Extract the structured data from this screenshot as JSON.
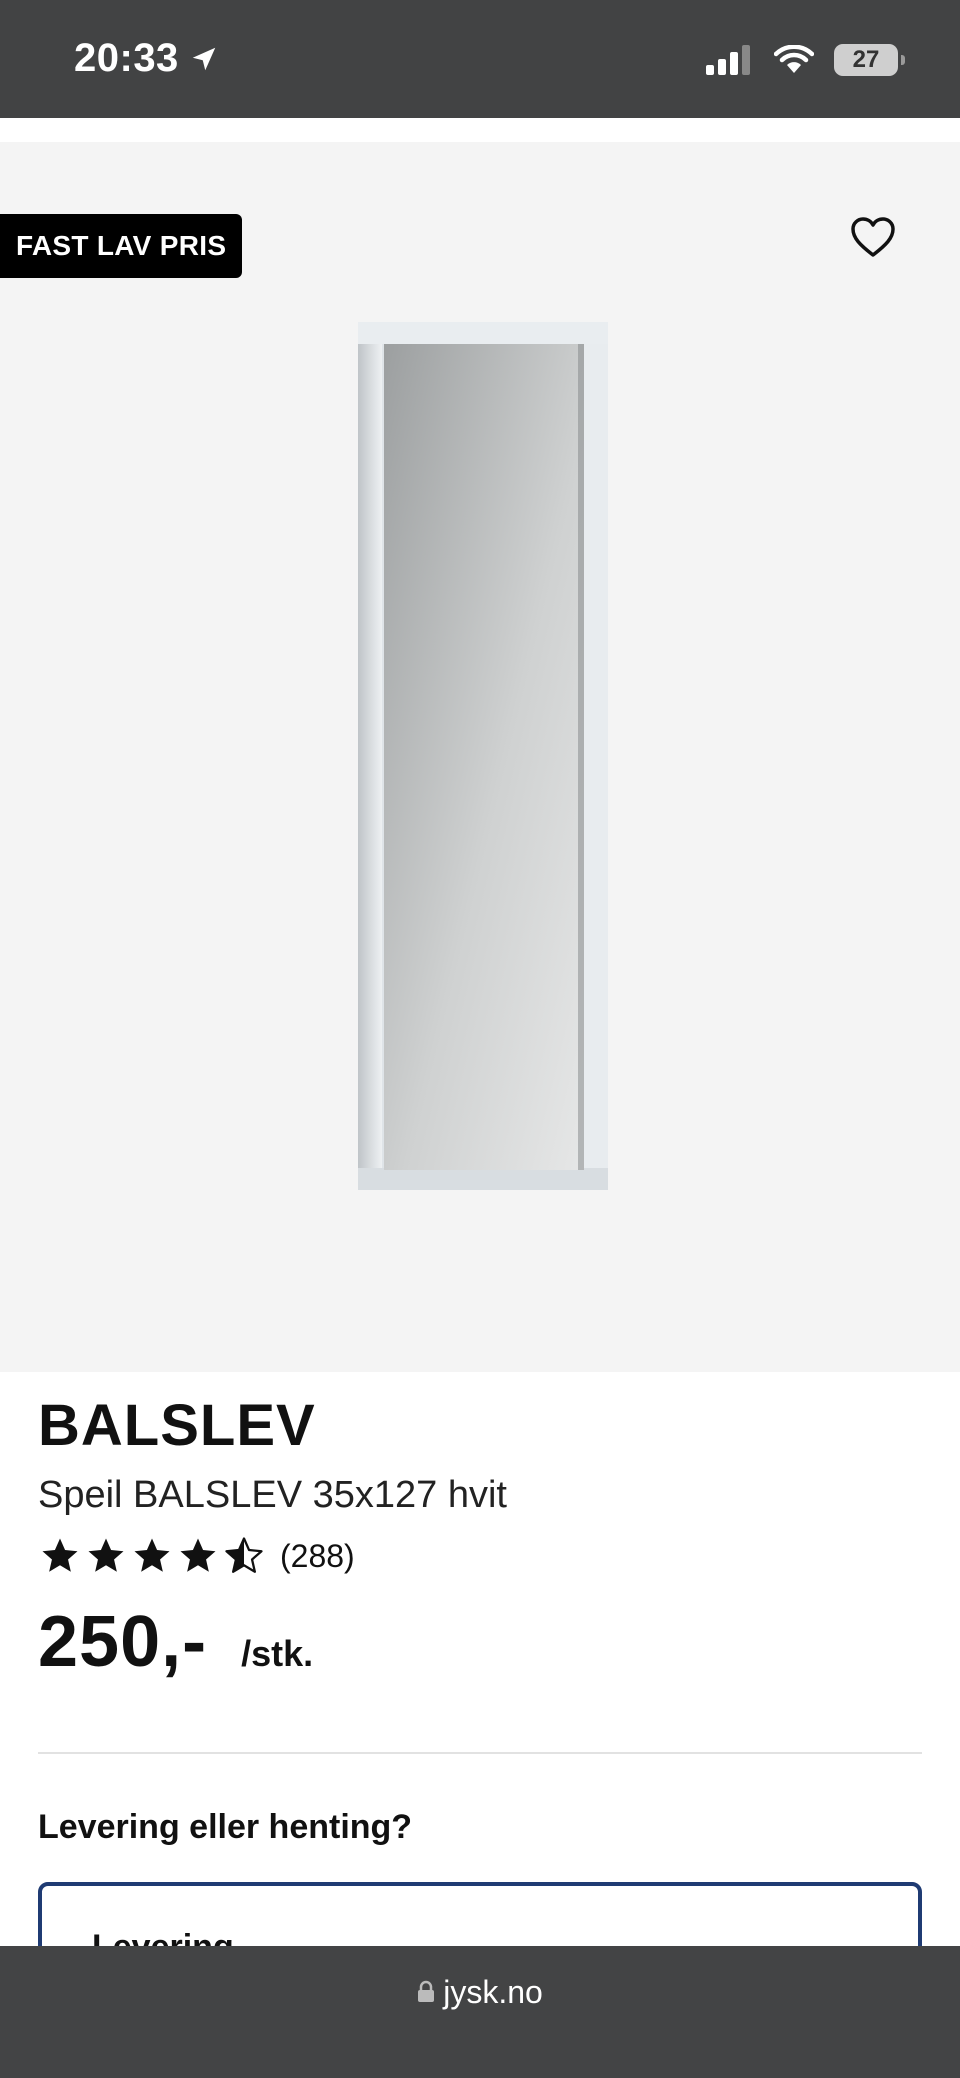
{
  "status_bar": {
    "time": "20:33",
    "battery": "27"
  },
  "product": {
    "badge": "FAST LAV PRIS",
    "brand": "BALSLEV",
    "subtitle": "Speil BALSLEV 35x127 hvit",
    "rating_stars": 4.5,
    "rating_count": "(288)",
    "price": "250,-",
    "unit": "/stk."
  },
  "delivery": {
    "heading": "Levering eller henting?",
    "option_label": "Levering"
  },
  "browser": {
    "url": "jysk.no"
  },
  "colors": {
    "status_bg": "#424344",
    "hero_bg": "#f4f4f4",
    "card_border": "#1f3b73"
  }
}
